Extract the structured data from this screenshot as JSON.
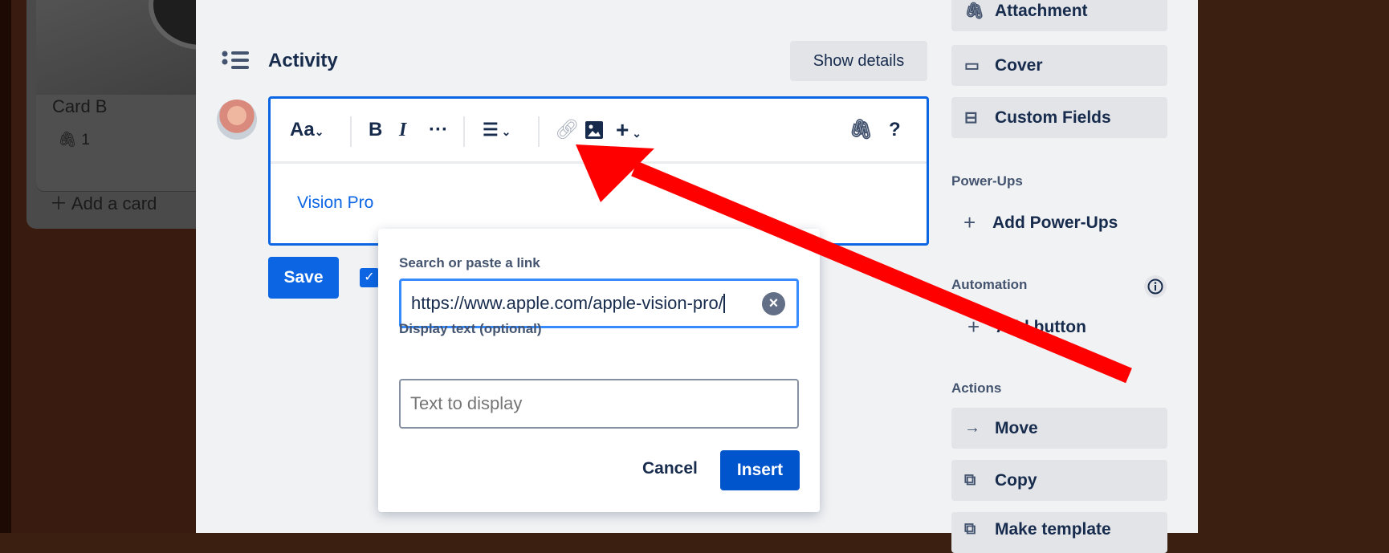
{
  "board": {
    "card_title": "Card B",
    "attachment_count": "1",
    "add_card": "Add a card"
  },
  "activity": {
    "title": "Activity",
    "show_details": "Show details"
  },
  "editor": {
    "font_label": "Aa",
    "bold": "B",
    "italic": "I",
    "more": "···",
    "content_link": "Vision Pro",
    "help": "?"
  },
  "save_label": "Save",
  "link_popup": {
    "search_label": "Search or paste a link",
    "url_value": "https://www.apple.com/apple-vision-pro/",
    "display_label": "Display text (optional)",
    "display_placeholder": "Text to display",
    "cancel": "Cancel",
    "insert": "Insert"
  },
  "sidebar": {
    "top_buttons": [
      {
        "label": "Attachment",
        "icon": "paperclip-icon"
      },
      {
        "label": "Cover",
        "icon": "cover-icon"
      },
      {
        "label": "Custom Fields",
        "icon": "custom-fields-icon"
      }
    ],
    "powerups_heading": "Power-Ups",
    "add_powerups": "Add Power-Ups",
    "automation_heading": "Automation",
    "add_button": "Add button",
    "actions_heading": "Actions",
    "actions": [
      {
        "label": "Move",
        "icon": "arrow-right-icon"
      },
      {
        "label": "Copy",
        "icon": "copy-icon"
      },
      {
        "label": "Make template",
        "icon": "template-icon"
      }
    ]
  },
  "annotation_color": "#ff0000"
}
